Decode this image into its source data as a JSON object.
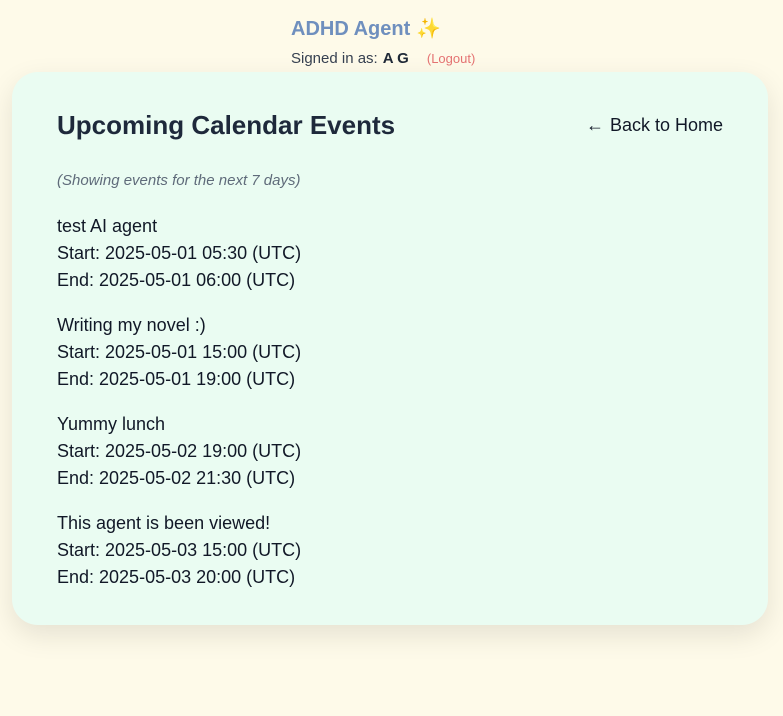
{
  "header": {
    "app_title": "ADHD Agent",
    "signed_in_label": "Signed in as:",
    "user_name": "A G",
    "logout_label": "(Logout)"
  },
  "page": {
    "title": "Upcoming Calendar Events",
    "back_label": "Back to Home",
    "subtitle": "(Showing events for the next 7 days)"
  },
  "events": [
    {
      "title": "test AI agent",
      "start": "Start: 2025-05-01 05:30 (UTC)",
      "end": "End: 2025-05-01 06:00 (UTC)"
    },
    {
      "title": "Writing my novel :)",
      "start": "Start: 2025-05-01 15:00 (UTC)",
      "end": "End: 2025-05-01 19:00 (UTC)"
    },
    {
      "title": "Yummy lunch",
      "start": "Start: 2025-05-02 19:00 (UTC)",
      "end": "End: 2025-05-02 21:30 (UTC)"
    },
    {
      "title": "This agent is been viewed!",
      "start": "Start: 2025-05-03 15:00 (UTC)",
      "end": "End: 2025-05-03 20:00 (UTC)"
    }
  ],
  "icons": {
    "sparkle": "sparkles-icon",
    "back": "arrow-left-icon"
  },
  "colors": {
    "background": "#fefae9",
    "card": "#eafcf2",
    "app_title": "#6f8fbe",
    "logout": "#e57373"
  }
}
